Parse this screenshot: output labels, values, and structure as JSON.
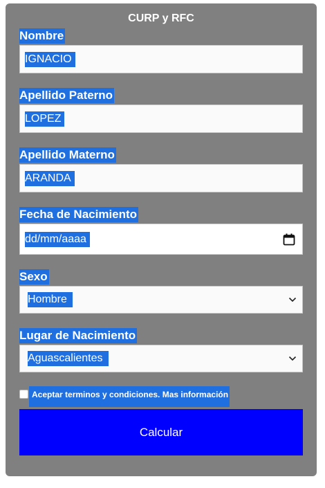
{
  "form": {
    "title": "CURP y RFC",
    "nombre": {
      "label": "Nombre",
      "value": "IGNACIO"
    },
    "apellido_paterno": {
      "label": "Apellido Paterno",
      "value": "LOPEZ"
    },
    "apellido_materno": {
      "label": "Apellido Materno",
      "value": "ARANDA"
    },
    "fecha_nacimiento": {
      "label": "Fecha de Nacimiento",
      "placeholder": "dd/mm/aaaa",
      "icon": "calendar-icon"
    },
    "sexo": {
      "label": "Sexo",
      "selected": "Hombre",
      "icon": "chevron-down-icon"
    },
    "lugar_nacimiento": {
      "label": "Lugar de Nacimiento",
      "selected": "Aguascalientes",
      "icon": "chevron-down-icon"
    },
    "terms": {
      "checked": false,
      "label": "Aceptar terminos y condiciones. Mas información"
    },
    "submit_label": "Calcular"
  },
  "colors": {
    "card_background": "#808080",
    "selection_highlight": "#1f6fe0",
    "button_background": "#0000ff",
    "text_light": "#ffffff"
  }
}
